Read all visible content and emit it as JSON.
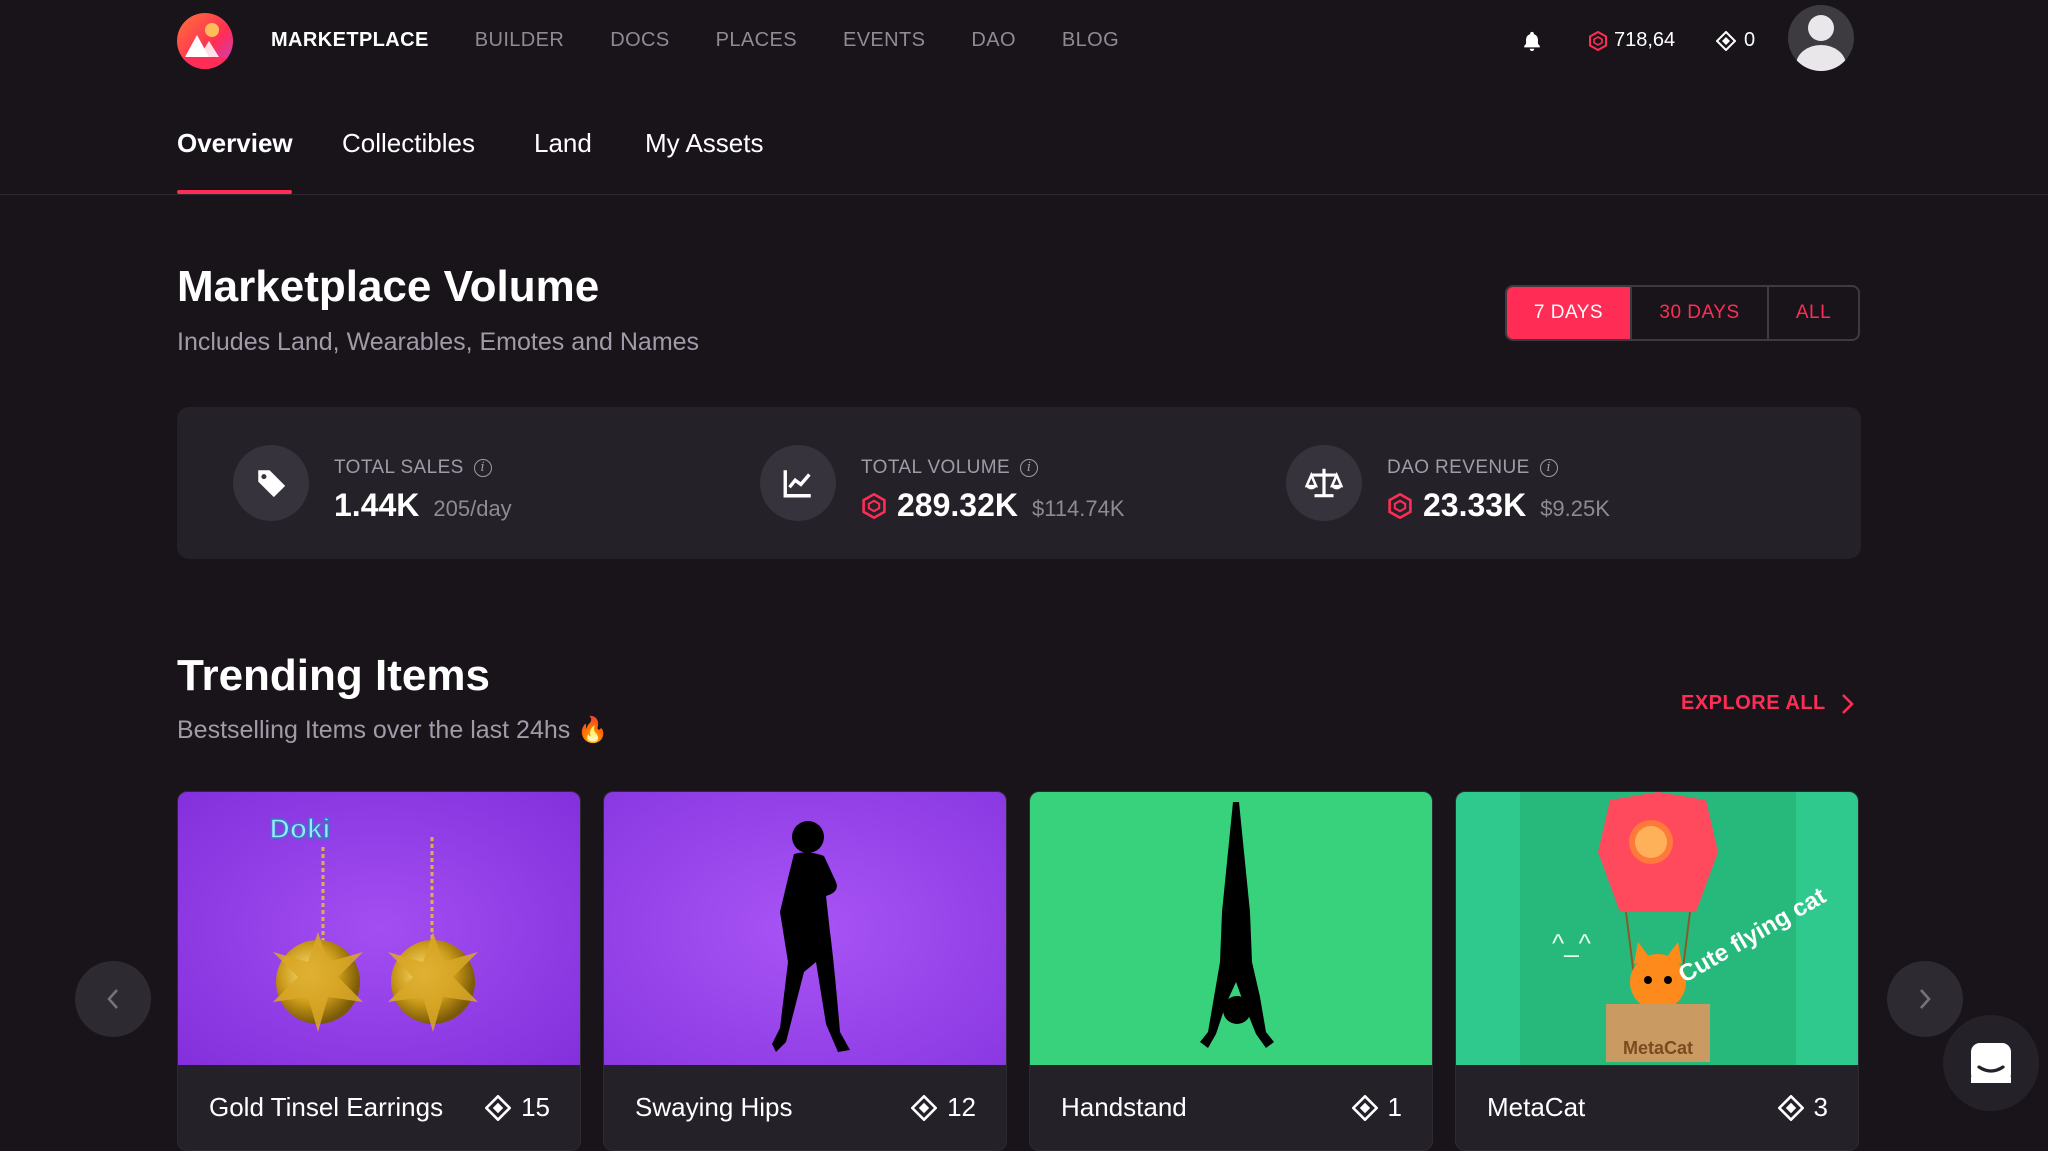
{
  "nav": {
    "links": [
      "MARKETPLACE",
      "BUILDER",
      "DOCS",
      "PLACES",
      "EVENTS",
      "DAO",
      "BLOG"
    ],
    "mana_balance": "718,64",
    "eth_balance": "0"
  },
  "tabs": [
    "Overview",
    "Collectibles",
    "Land",
    "My Assets"
  ],
  "volume": {
    "title": "Marketplace Volume",
    "subtitle": "Includes Land, Wearables, Emotes and Names",
    "periods": [
      "7 DAYS",
      "30 DAYS",
      "ALL"
    ],
    "selected_period": "7 DAYS",
    "stats": [
      {
        "label": "TOTAL SALES",
        "value": "1.44K",
        "secondary": "205/day",
        "icon": "tag-icon"
      },
      {
        "label": "TOTAL VOLUME",
        "value": "289.32K",
        "secondary": "$114.74K",
        "icon": "chart-icon"
      },
      {
        "label": "DAO REVENUE",
        "value": "23.33K",
        "secondary": "$9.25K",
        "icon": "scale-icon"
      }
    ]
  },
  "trending": {
    "title": "Trending Items",
    "subtitle": "Bestselling Items over the last 24hs 🔥",
    "explore_label": "EXPLORE ALL",
    "items": [
      {
        "name": "Gold Tinsel Earrings",
        "price": "15",
        "bg": "#8b34e0"
      },
      {
        "name": "Swaying Hips",
        "price": "12",
        "bg": "#9040e6"
      },
      {
        "name": "Handstand",
        "price": "1",
        "bg": "#36d07a"
      },
      {
        "name": "MetaCat",
        "price": "3",
        "bg": "#2ec68b"
      }
    ],
    "thumb_text": {
      "doki": "Doki",
      "cute": "Cute flying cat",
      "metacat_box": "MetaCat",
      "cat_face": "^_^"
    }
  },
  "colors": {
    "accent": "#ff2d55",
    "background": "#18141a",
    "panel": "#242129"
  }
}
